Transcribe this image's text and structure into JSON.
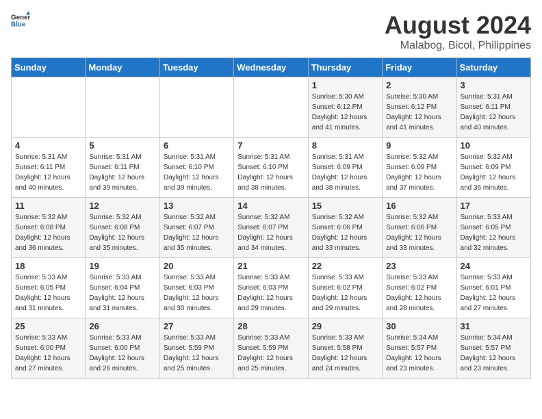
{
  "header": {
    "logo_general": "General",
    "logo_blue": "Blue",
    "title": "August 2024",
    "subtitle": "Malabog, Bicol, Philippines"
  },
  "days_of_week": [
    "Sunday",
    "Monday",
    "Tuesday",
    "Wednesday",
    "Thursday",
    "Friday",
    "Saturday"
  ],
  "weeks": [
    [
      {
        "day": "",
        "info": ""
      },
      {
        "day": "",
        "info": ""
      },
      {
        "day": "",
        "info": ""
      },
      {
        "day": "",
        "info": ""
      },
      {
        "day": "1",
        "info": "Sunrise: 5:30 AM\nSunset: 6:12 PM\nDaylight: 12 hours\nand 41 minutes."
      },
      {
        "day": "2",
        "info": "Sunrise: 5:30 AM\nSunset: 6:12 PM\nDaylight: 12 hours\nand 41 minutes."
      },
      {
        "day": "3",
        "info": "Sunrise: 5:31 AM\nSunset: 6:11 PM\nDaylight: 12 hours\nand 40 minutes."
      }
    ],
    [
      {
        "day": "4",
        "info": "Sunrise: 5:31 AM\nSunset: 6:11 PM\nDaylight: 12 hours\nand 40 minutes."
      },
      {
        "day": "5",
        "info": "Sunrise: 5:31 AM\nSunset: 6:11 PM\nDaylight: 12 hours\nand 39 minutes."
      },
      {
        "day": "6",
        "info": "Sunrise: 5:31 AM\nSunset: 6:10 PM\nDaylight: 12 hours\nand 39 minutes."
      },
      {
        "day": "7",
        "info": "Sunrise: 5:31 AM\nSunset: 6:10 PM\nDaylight: 12 hours\nand 38 minutes."
      },
      {
        "day": "8",
        "info": "Sunrise: 5:31 AM\nSunset: 6:09 PM\nDaylight: 12 hours\nand 38 minutes."
      },
      {
        "day": "9",
        "info": "Sunrise: 5:32 AM\nSunset: 6:09 PM\nDaylight: 12 hours\nand 37 minutes."
      },
      {
        "day": "10",
        "info": "Sunrise: 5:32 AM\nSunset: 6:09 PM\nDaylight: 12 hours\nand 36 minutes."
      }
    ],
    [
      {
        "day": "11",
        "info": "Sunrise: 5:32 AM\nSunset: 6:08 PM\nDaylight: 12 hours\nand 36 minutes."
      },
      {
        "day": "12",
        "info": "Sunrise: 5:32 AM\nSunset: 6:08 PM\nDaylight: 12 hours\nand 35 minutes."
      },
      {
        "day": "13",
        "info": "Sunrise: 5:32 AM\nSunset: 6:07 PM\nDaylight: 12 hours\nand 35 minutes."
      },
      {
        "day": "14",
        "info": "Sunrise: 5:32 AM\nSunset: 6:07 PM\nDaylight: 12 hours\nand 34 minutes."
      },
      {
        "day": "15",
        "info": "Sunrise: 5:32 AM\nSunset: 6:06 PM\nDaylight: 12 hours\nand 33 minutes."
      },
      {
        "day": "16",
        "info": "Sunrise: 5:32 AM\nSunset: 6:06 PM\nDaylight: 12 hours\nand 33 minutes."
      },
      {
        "day": "17",
        "info": "Sunrise: 5:33 AM\nSunset: 6:05 PM\nDaylight: 12 hours\nand 32 minutes."
      }
    ],
    [
      {
        "day": "18",
        "info": "Sunrise: 5:33 AM\nSunset: 6:05 PM\nDaylight: 12 hours\nand 31 minutes."
      },
      {
        "day": "19",
        "info": "Sunrise: 5:33 AM\nSunset: 6:04 PM\nDaylight: 12 hours\nand 31 minutes."
      },
      {
        "day": "20",
        "info": "Sunrise: 5:33 AM\nSunset: 6:03 PM\nDaylight: 12 hours\nand 30 minutes."
      },
      {
        "day": "21",
        "info": "Sunrise: 5:33 AM\nSunset: 6:03 PM\nDaylight: 12 hours\nand 29 minutes."
      },
      {
        "day": "22",
        "info": "Sunrise: 5:33 AM\nSunset: 6:02 PM\nDaylight: 12 hours\nand 29 minutes."
      },
      {
        "day": "23",
        "info": "Sunrise: 5:33 AM\nSunset: 6:02 PM\nDaylight: 12 hours\nand 28 minutes."
      },
      {
        "day": "24",
        "info": "Sunrise: 5:33 AM\nSunset: 6:01 PM\nDaylight: 12 hours\nand 27 minutes."
      }
    ],
    [
      {
        "day": "25",
        "info": "Sunrise: 5:33 AM\nSunset: 6:00 PM\nDaylight: 12 hours\nand 27 minutes."
      },
      {
        "day": "26",
        "info": "Sunrise: 5:33 AM\nSunset: 6:00 PM\nDaylight: 12 hours\nand 26 minutes."
      },
      {
        "day": "27",
        "info": "Sunrise: 5:33 AM\nSunset: 5:59 PM\nDaylight: 12 hours\nand 25 minutes."
      },
      {
        "day": "28",
        "info": "Sunrise: 5:33 AM\nSunset: 5:59 PM\nDaylight: 12 hours\nand 25 minutes."
      },
      {
        "day": "29",
        "info": "Sunrise: 5:33 AM\nSunset: 5:58 PM\nDaylight: 12 hours\nand 24 minutes."
      },
      {
        "day": "30",
        "info": "Sunrise: 5:34 AM\nSunset: 5:57 PM\nDaylight: 12 hours\nand 23 minutes."
      },
      {
        "day": "31",
        "info": "Sunrise: 5:34 AM\nSunset: 5:57 PM\nDaylight: 12 hours\nand 23 minutes."
      }
    ]
  ]
}
